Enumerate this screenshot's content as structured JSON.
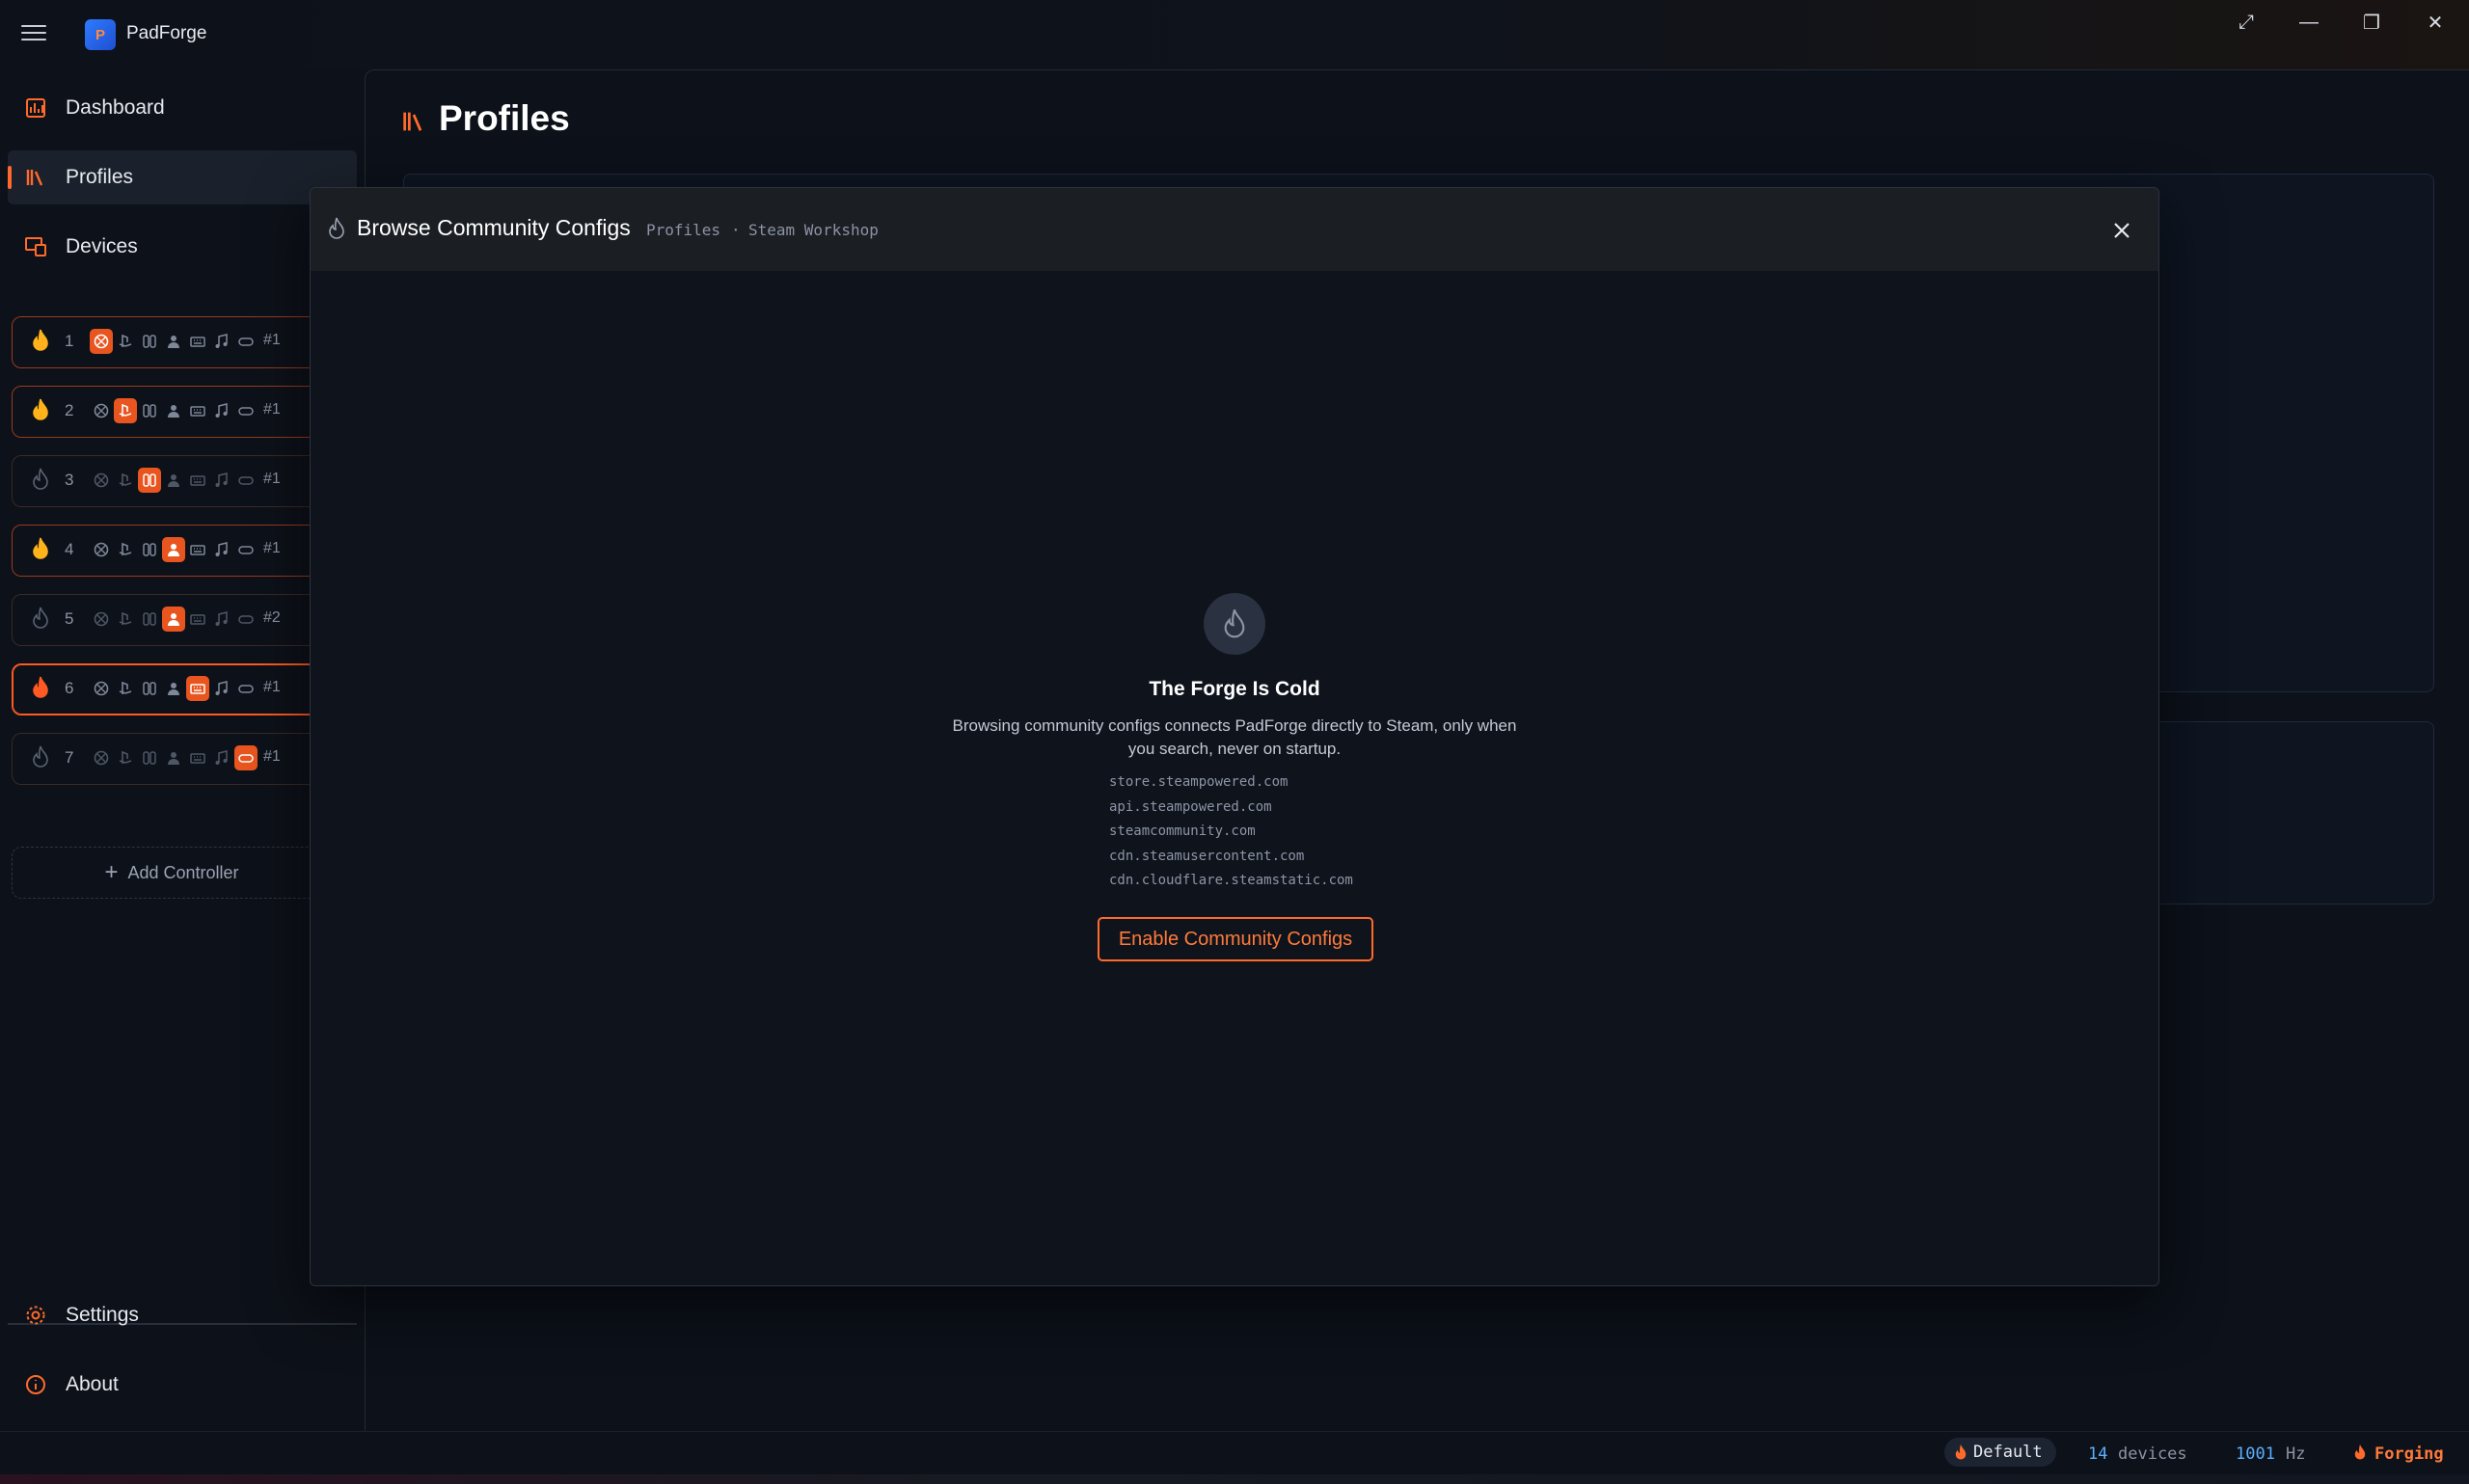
{
  "app": {
    "title": "PadForge"
  },
  "sidebar": {
    "nav": [
      {
        "label": "Dashboard",
        "icon": "dashboard-icon"
      },
      {
        "label": "Profiles",
        "icon": "profiles-icon"
      },
      {
        "label": "Devices",
        "icon": "devices-icon"
      }
    ],
    "slots": [
      {
        "number": "1",
        "tag": "#1",
        "state": "on"
      },
      {
        "number": "2",
        "tag": "#1",
        "state": "on"
      },
      {
        "number": "3",
        "tag": "#1",
        "state": "off"
      },
      {
        "number": "4",
        "tag": "#1",
        "state": "on"
      },
      {
        "number": "5",
        "tag": "#2",
        "state": "off"
      },
      {
        "number": "6",
        "tag": "#1",
        "state": "selected"
      },
      {
        "number": "7",
        "tag": "#1",
        "state": "off"
      }
    ],
    "add_controller_label": "Add Controller",
    "footer": [
      {
        "label": "Settings",
        "icon": "gear-icon"
      },
      {
        "label": "About",
        "icon": "info-icon"
      }
    ]
  },
  "page": {
    "title": "Profiles"
  },
  "modal": {
    "title": "Browse Community Configs",
    "breadcrumb": [
      "Profiles",
      "·",
      "Steam Workshop"
    ],
    "empty_title": "The Forge Is Cold",
    "empty_description": "Browsing community configs connects PadForge directly to Steam, only when you search, never on startup.",
    "hosts": [
      "store.steampowered.com",
      "api.steampowered.com",
      "steamcommunity.com",
      "cdn.steamusercontent.com",
      "cdn.cloudflare.steamstatic.com"
    ],
    "enable_button": "Enable Community Configs"
  },
  "status": {
    "profile": "Default",
    "device_count": "14",
    "devices_label": "devices",
    "rate": "1001",
    "rate_unit": "Hz",
    "state": "Forging"
  },
  "colors": {
    "accent": "#ff6a2b",
    "background": "#0d1119",
    "modal_header": "#1b1e23"
  }
}
